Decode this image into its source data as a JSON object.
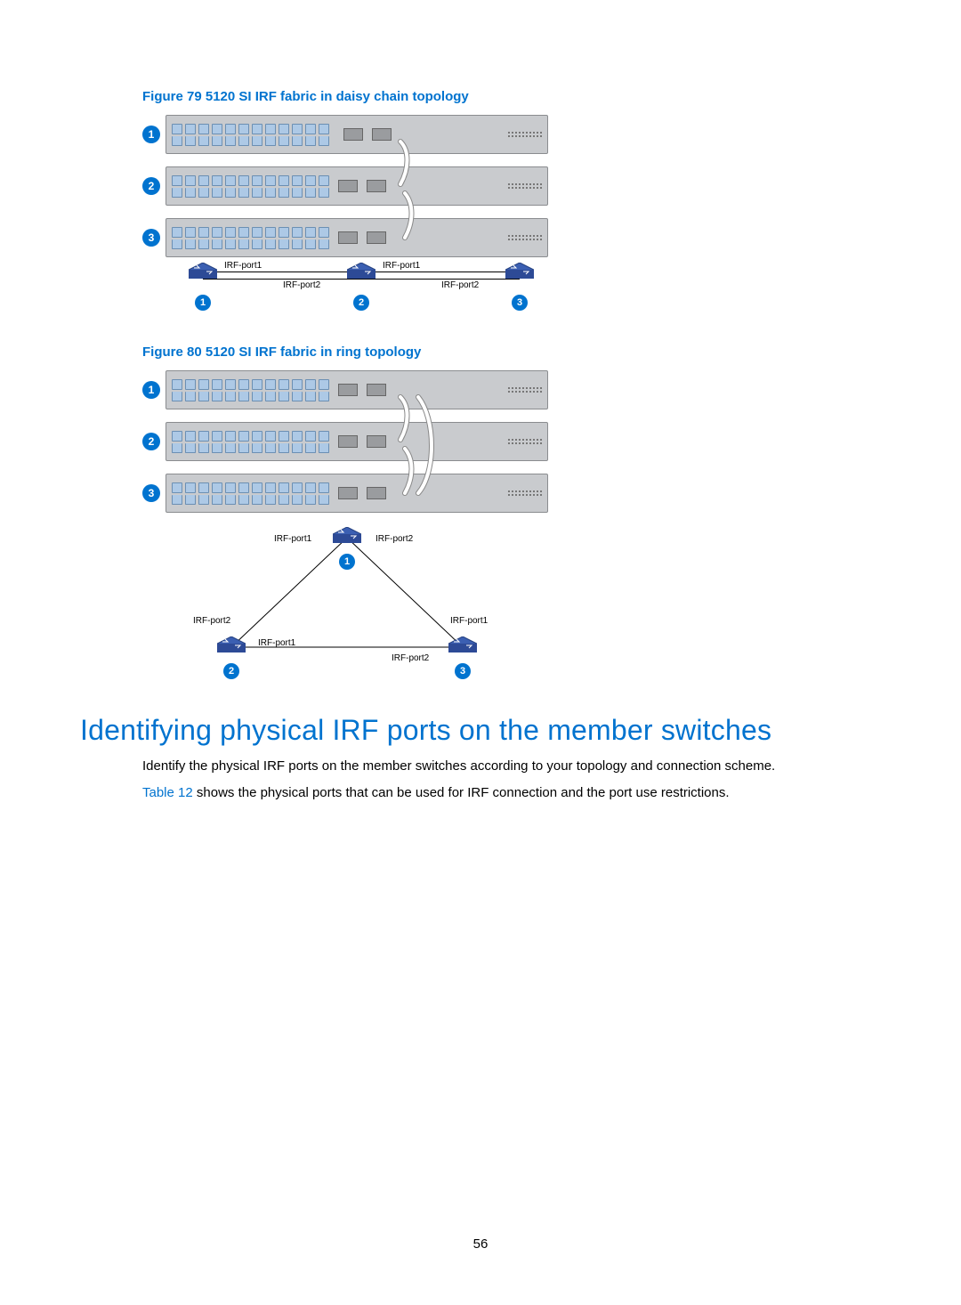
{
  "page_number": "56",
  "figure79": {
    "caption": "Figure 79 5120 SI IRF fabric in daisy chain topology",
    "stack_labels": [
      "1",
      "2",
      "3"
    ],
    "nodes": [
      "1",
      "2",
      "3"
    ],
    "port_labels": {
      "n1_right": "IRF-port1",
      "n1_2_link": "IRF-port2",
      "n2_right": "IRF-port1",
      "n2_3_link": "IRF-port2"
    }
  },
  "figure80": {
    "caption": "Figure 80 5120 SI IRF fabric in ring topology",
    "stack_labels": [
      "1",
      "2",
      "3"
    ],
    "nodes": [
      "1",
      "2",
      "3"
    ],
    "port_labels": {
      "top_left": "IRF-port1",
      "top_right": "IRF-port2",
      "left_up": "IRF-port2",
      "left_right": "IRF-port1",
      "right_up": "IRF-port1",
      "right_left": "IRF-port2"
    }
  },
  "section": {
    "heading": "Identifying physical IRF ports on the member switches",
    "para1": "Identify the physical IRF ports on the member switches according to your topology and connection scheme.",
    "para2_link": "Table 12",
    "para2_rest": " shows the physical ports that can be used for IRF connection and the port use restrictions."
  }
}
